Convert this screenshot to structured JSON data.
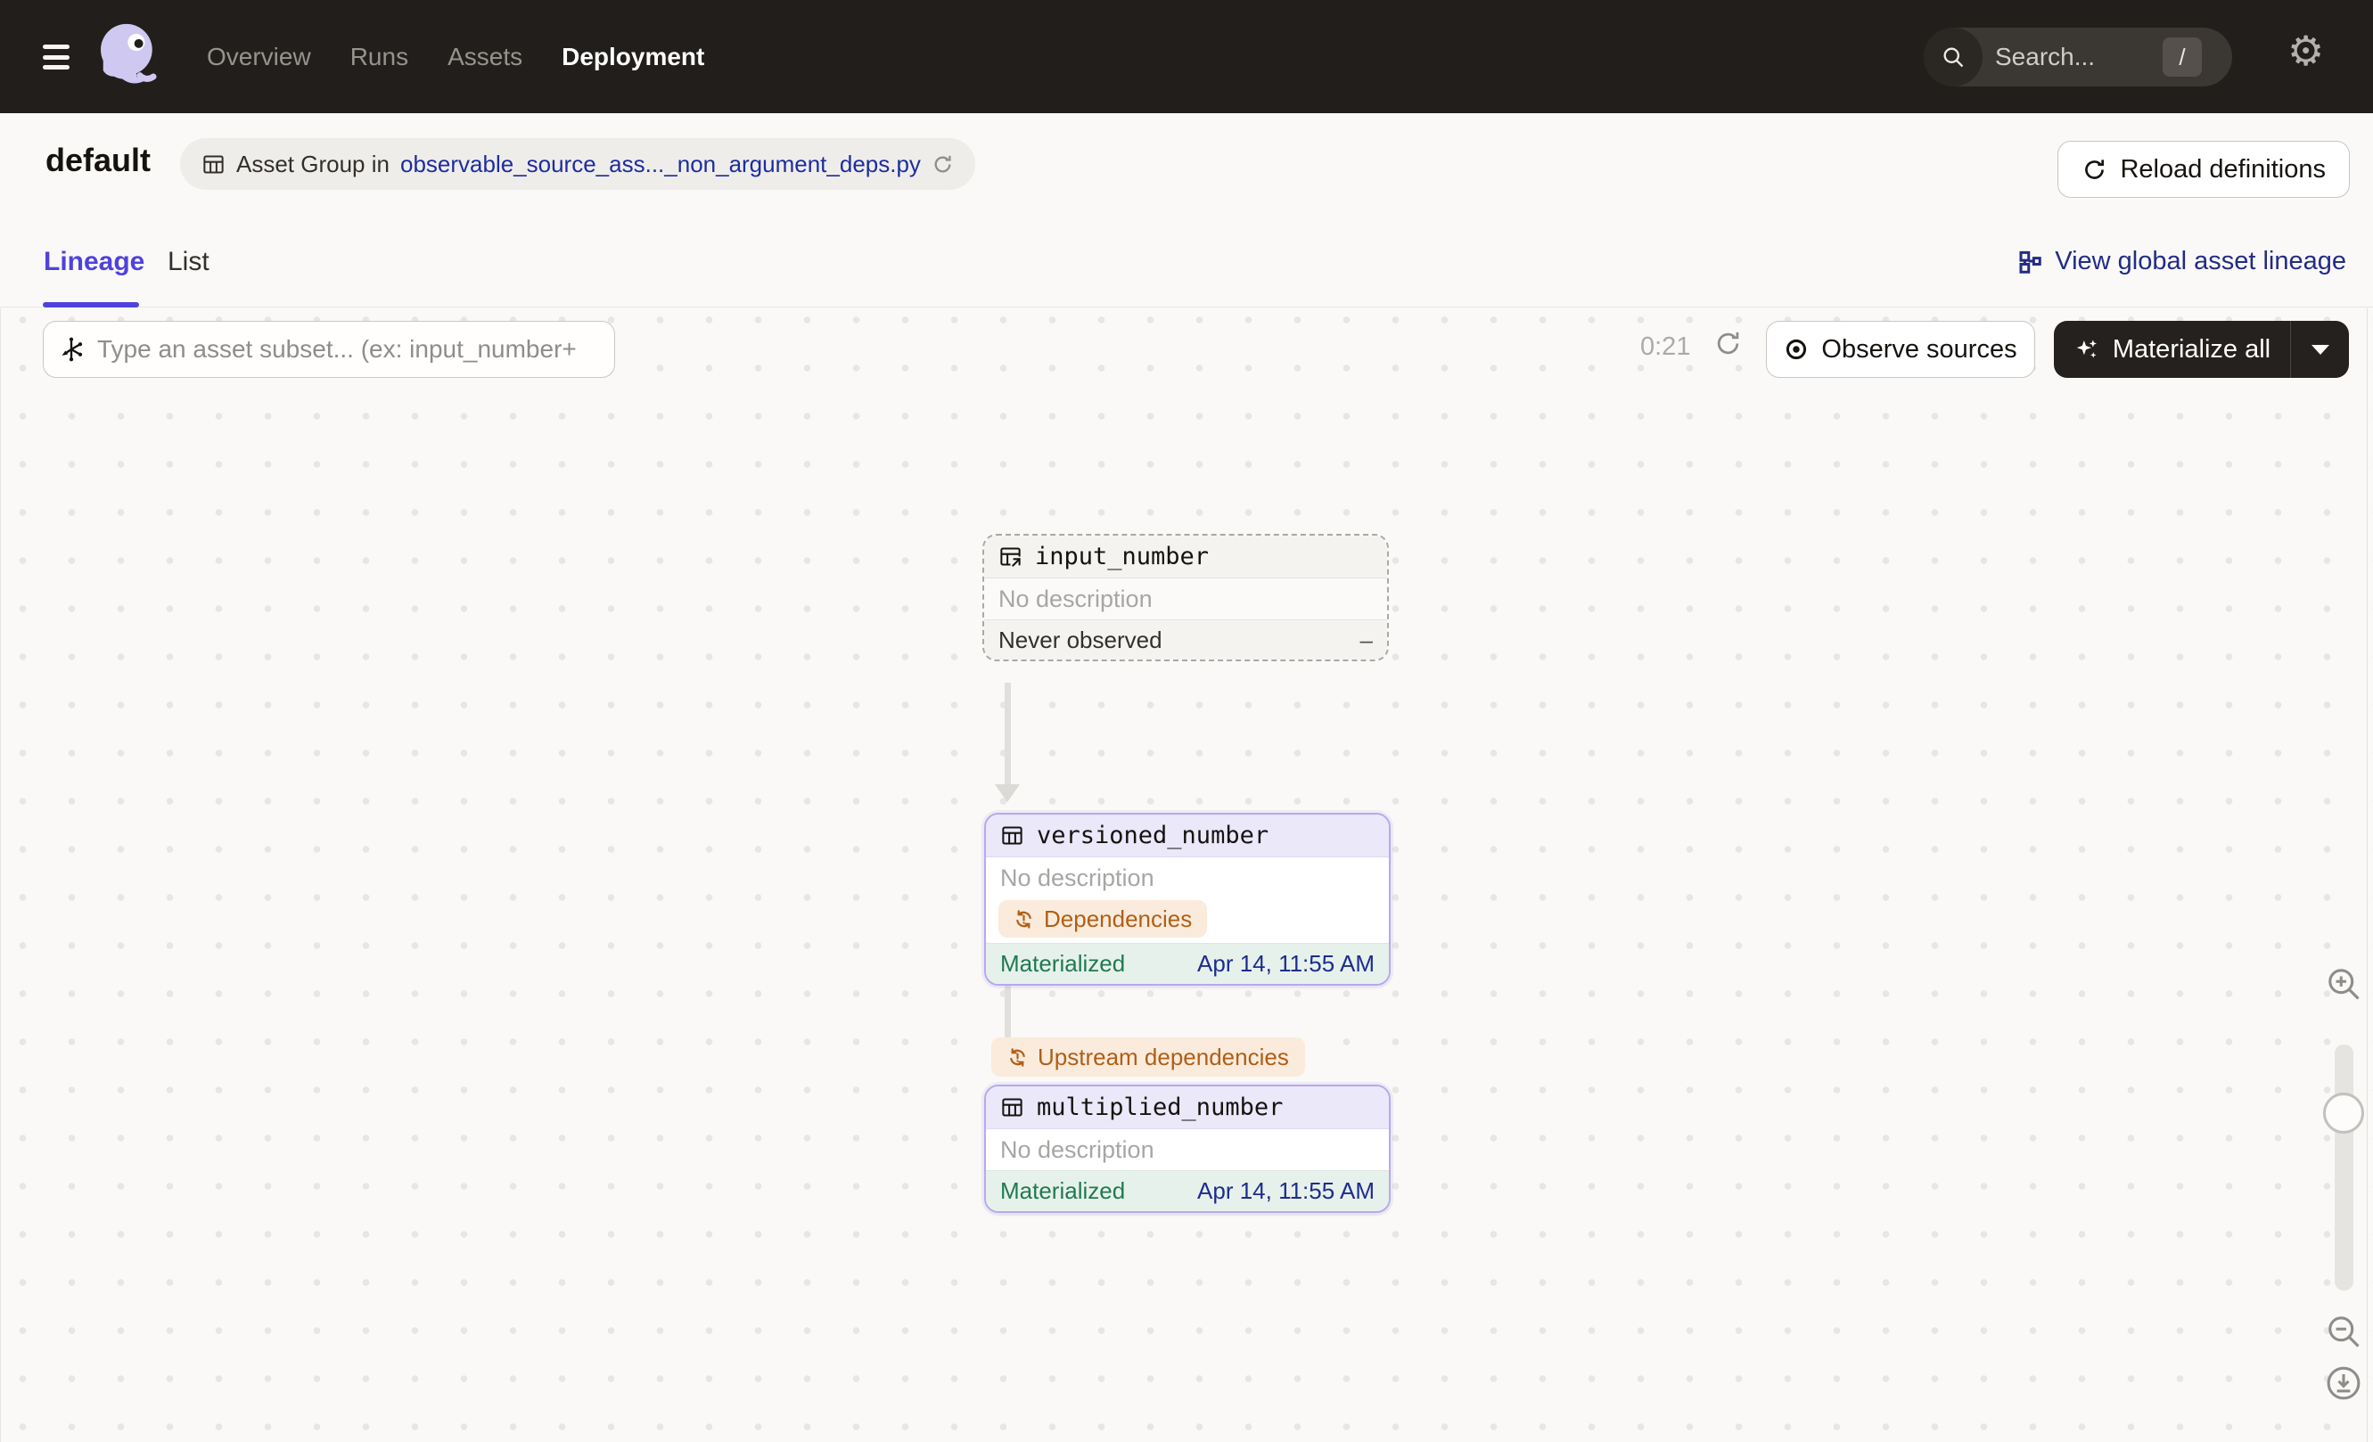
{
  "topbar": {
    "nav": [
      {
        "label": "Overview"
      },
      {
        "label": "Runs"
      },
      {
        "label": "Assets"
      },
      {
        "label": "Deployment"
      }
    ],
    "search_placeholder": "Search...",
    "search_shortcut": "/"
  },
  "header": {
    "title": "default",
    "badge_prefix": "Asset Group in",
    "badge_link": "observable_source_ass..._non_argument_deps.py",
    "reload_button": "Reload definitions"
  },
  "tabs": {
    "items": [
      {
        "label": "Lineage",
        "active": true
      },
      {
        "label": "List",
        "active": false
      }
    ],
    "global_link": "View global asset lineage"
  },
  "toolbar": {
    "subset_placeholder": "Type an asset subset... (ex: input_number+",
    "timer": "0:21",
    "observe_button": "Observe sources",
    "materialize_button": "Materialize all"
  },
  "graph": {
    "edge_label": "Upstream dependencies",
    "nodes": [
      {
        "name": "input_number",
        "description": "No description",
        "status": "Never observed",
        "status_value": "–",
        "kind": "observable-source"
      },
      {
        "name": "versioned_number",
        "description": "No description",
        "tag": "Dependencies",
        "status": "Materialized",
        "status_value": "Apr 14, 11:55 AM",
        "kind": "materialized"
      },
      {
        "name": "multiplied_number",
        "description": "No description",
        "status": "Materialized",
        "status_value": "Apr 14, 11:55 AM",
        "kind": "materialized"
      }
    ]
  },
  "colors": {
    "topbar_bg": "#221E1B",
    "accent_purple": "#4F43DD",
    "node_border_purple": "#B7A8F0",
    "node_title_purple_bg": "#EBE8FA",
    "link_navy": "#1D2D9E",
    "warn_orange": "#B05F16",
    "warn_bg": "#FAEBDC",
    "success_green": "#207A52",
    "success_bg": "#E7F1EB"
  }
}
